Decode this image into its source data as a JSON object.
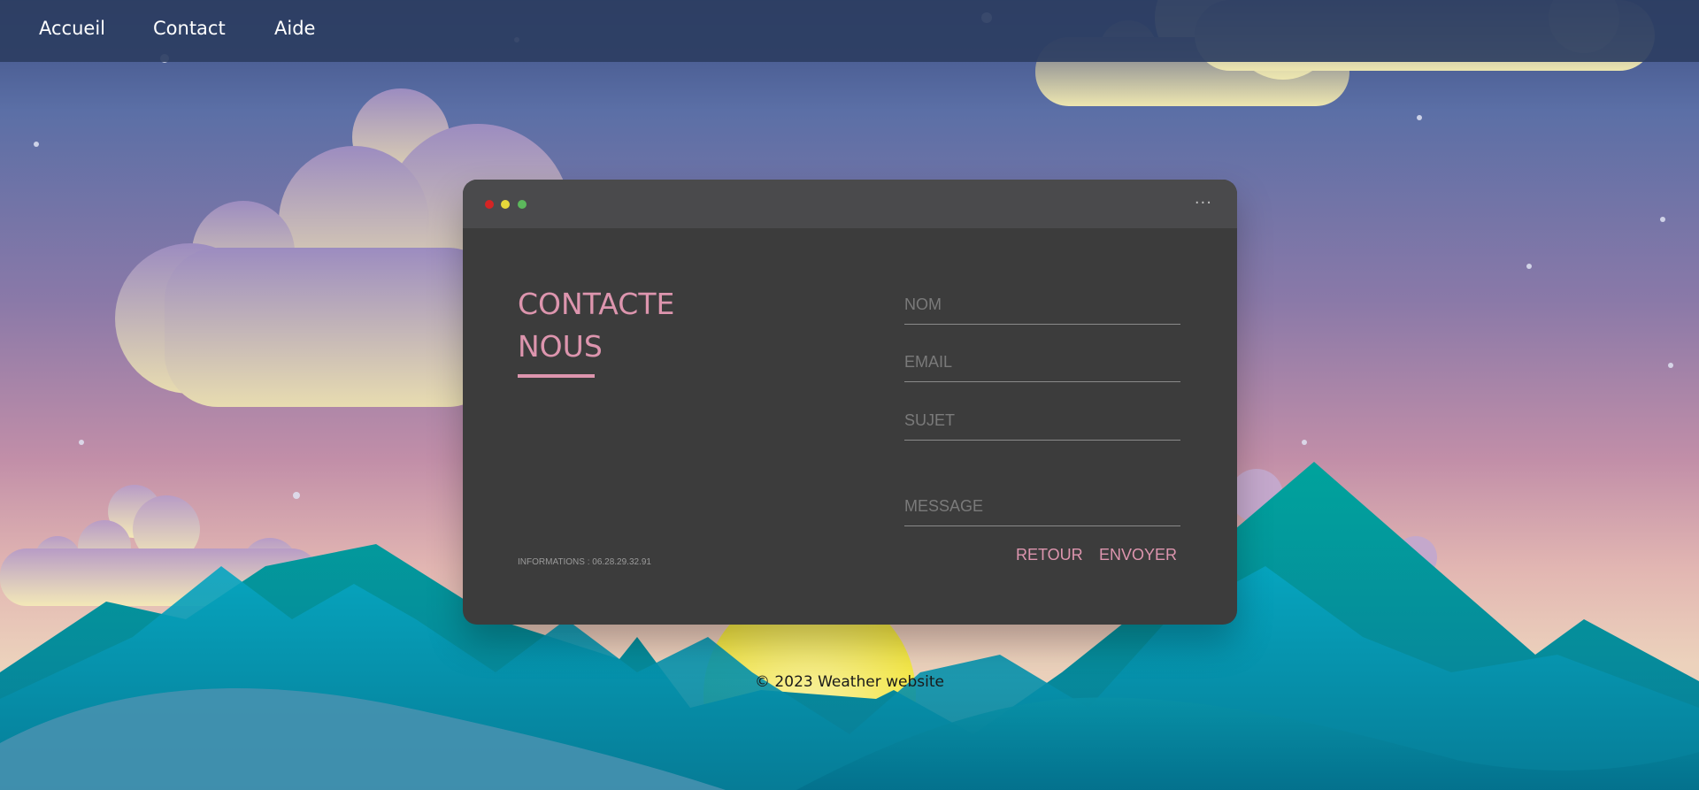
{
  "nav": {
    "items": [
      "Accueil",
      "Contact",
      "Aide"
    ]
  },
  "window": {
    "controls": {
      "close": "#d42424",
      "minimize": "#e6d83a",
      "maximize": "#5cb85c"
    },
    "menu_label": "···"
  },
  "contact": {
    "title_line1": "CONTACTE",
    "title_line2": "NOUS",
    "info": "INFORMATIONS : 06.28.29.32.91",
    "fields": {
      "name_placeholder": "NOM",
      "email_placeholder": "EMAIL",
      "subject_placeholder": "SUJET",
      "message_placeholder": "MESSAGE"
    },
    "back_label": "RETOUR",
    "send_label": "ENVOYER"
  },
  "footer": {
    "text": "© 2023 Weather website"
  },
  "colors": {
    "accent": "#dd95ae",
    "card": "#3c3c3c",
    "titlebar": "#4a4a4c",
    "nav": "#2c3e62"
  }
}
